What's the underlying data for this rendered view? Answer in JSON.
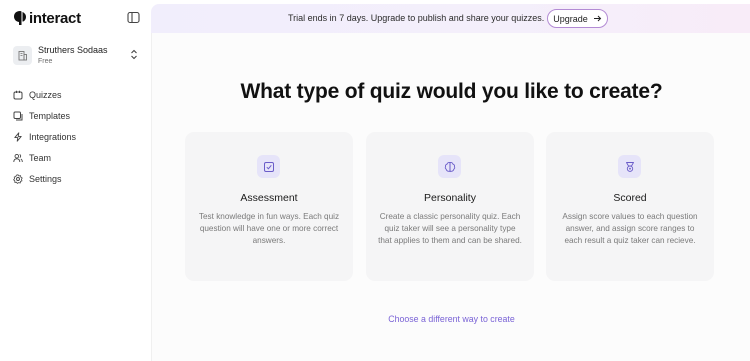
{
  "app": {
    "logo_text": "interact"
  },
  "org": {
    "name": "Struthers Sodaas",
    "plan": "Free"
  },
  "sidebar": {
    "items": [
      {
        "label": "Quizzes",
        "icon": "quiz-icon"
      },
      {
        "label": "Templates",
        "icon": "templates-icon"
      },
      {
        "label": "Integrations",
        "icon": "lightning-icon"
      },
      {
        "label": "Team",
        "icon": "team-icon"
      },
      {
        "label": "Settings",
        "icon": "gear-icon"
      }
    ]
  },
  "banner": {
    "text": "Trial ends in 7 days. Upgrade to publish and share your quizzes.",
    "upgrade_label": "Upgrade"
  },
  "main": {
    "heading": "What type of quiz would you like to create?",
    "cards": [
      {
        "title": "Assessment",
        "description": "Test knowledge in fun ways. Each quiz question will have one or more correct answers.",
        "icon": "checkbox-icon"
      },
      {
        "title": "Personality",
        "description": "Create a classic personality quiz. Each quiz taker will see a personality type that applies to them and can be shared.",
        "icon": "brain-icon"
      },
      {
        "title": "Scored",
        "description": "Assign score values to each question answer, and assign score ranges to each result a quiz taker can recieve.",
        "icon": "medal-icon"
      }
    ],
    "alt_link": "Choose a different way to create"
  },
  "colors": {
    "accent": "#7a63d6",
    "icon_bg": "#e6e4f9",
    "banner_start": "#f1eefc",
    "banner_end": "#f8ecf8"
  }
}
